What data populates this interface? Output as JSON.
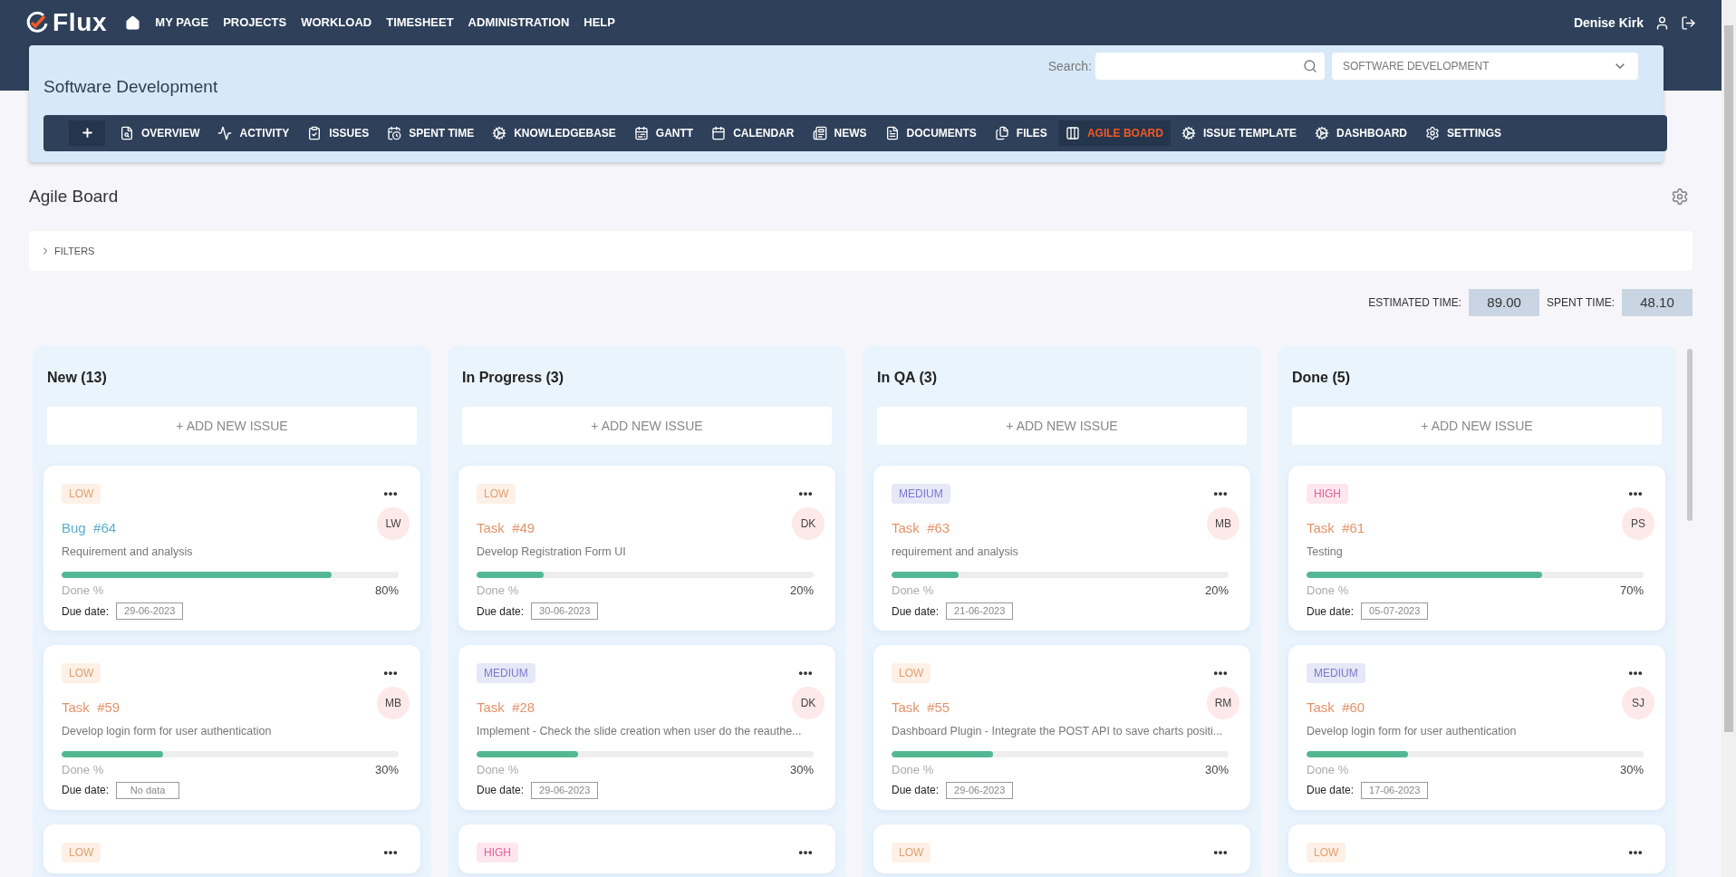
{
  "brand": {
    "name": "Flux"
  },
  "top_nav": [
    {
      "label": "MY PAGE"
    },
    {
      "label": "PROJECTS"
    },
    {
      "label": "WORKLOAD"
    },
    {
      "label": "TIMESHEET"
    },
    {
      "label": "ADMINISTRATION"
    },
    {
      "label": "HELP"
    }
  ],
  "user": {
    "name": "Denise Kirk"
  },
  "project": {
    "title": "Software Development",
    "search_label": "Search:",
    "project_select": "SOFTWARE DEVELOPMENT"
  },
  "project_nav": [
    {
      "label": "OVERVIEW",
      "selected": false
    },
    {
      "label": "ACTIVITY",
      "selected": false
    },
    {
      "label": "ISSUES",
      "selected": false
    },
    {
      "label": "SPENT TIME",
      "selected": false
    },
    {
      "label": "KNOWLEDGEBASE",
      "selected": false
    },
    {
      "label": "GANTT",
      "selected": false
    },
    {
      "label": "CALENDAR",
      "selected": false
    },
    {
      "label": "NEWS",
      "selected": false
    },
    {
      "label": "DOCUMENTS",
      "selected": false
    },
    {
      "label": "FILES",
      "selected": false
    },
    {
      "label": "AGILE BOARD",
      "selected": true
    },
    {
      "label": "ISSUE TEMPLATE",
      "selected": false
    },
    {
      "label": "DASHBOARD",
      "selected": false
    },
    {
      "label": "SETTINGS",
      "selected": false
    }
  ],
  "page_title": "Agile Board",
  "filters": {
    "label": "FILTERS",
    "expanded": false
  },
  "totals": [
    {
      "label": "ESTIMATED TIME:",
      "value": "89.00"
    },
    {
      "label": "SPENT TIME:",
      "value": "48.10"
    }
  ],
  "columns": [
    {
      "title": "New (13)",
      "add_label": "+ ADD NEW ISSUE",
      "cards": [
        {
          "priority": {
            "label": "LOW",
            "kind": "low"
          },
          "kind": "bug",
          "type": "Bug",
          "number": "#64",
          "assignee": "LW",
          "summary": "Requirement and analysis",
          "level": 0.8,
          "done_label": "Done %",
          "reading": "80%",
          "due_label": "Due date:",
          "due": "29-06-2023"
        },
        {
          "priority": {
            "label": "LOW",
            "kind": "low"
          },
          "kind": "task",
          "type": "Task",
          "number": "#59",
          "assignee": "MB",
          "summary": "Develop login form for user authentication",
          "level": 0.3,
          "done_label": "Done %",
          "reading": "30%",
          "due_label": "Due date:",
          "due": "No data"
        },
        {
          "priority": {
            "label": "LOW",
            "kind": "low"
          }
        }
      ]
    },
    {
      "title": "In Progress (3)",
      "add_label": "+ ADD NEW ISSUE",
      "cards": [
        {
          "priority": {
            "label": "LOW",
            "kind": "low"
          },
          "kind": "task",
          "type": "Task",
          "number": "#49",
          "assignee": "DK",
          "summary": "Develop Registration Form UI",
          "level": 0.2,
          "done_label": "Done %",
          "reading": "20%",
          "due_label": "Due date:",
          "due": "30-06-2023"
        },
        {
          "priority": {
            "label": "MEDIUM",
            "kind": "medium"
          },
          "kind": "task",
          "type": "Task",
          "number": "#28",
          "assignee": "DK",
          "summary": "Implement - Check the slide creation when user do the reauthe...",
          "level": 0.3,
          "done_label": "Done %",
          "reading": "30%",
          "due_label": "Due date:",
          "due": "29-06-2023"
        },
        {
          "priority": {
            "label": "HIGH",
            "kind": "high"
          }
        }
      ]
    },
    {
      "title": "In QA (3)",
      "add_label": "+ ADD NEW ISSUE",
      "cards": [
        {
          "priority": {
            "label": "MEDIUM",
            "kind": "medium"
          },
          "kind": "task",
          "type": "Task",
          "number": "#63",
          "assignee": "MB",
          "summary": "requirement and analysis",
          "level": 0.2,
          "done_label": "Done %",
          "reading": "20%",
          "due_label": "Due date:",
          "due": "21-06-2023"
        },
        {
          "priority": {
            "label": "LOW",
            "kind": "low"
          },
          "kind": "task",
          "type": "Task",
          "number": "#55",
          "assignee": "RM",
          "summary": "Dashboard Plugin - Integrate the POST API to save charts positi...",
          "level": 0.3,
          "done_label": "Done %",
          "reading": "30%",
          "due_label": "Due date:",
          "due": "29-06-2023"
        },
        {
          "priority": {
            "label": "LOW",
            "kind": "low"
          }
        }
      ]
    },
    {
      "title": "Done (5)",
      "add_label": "+ ADD NEW ISSUE",
      "cards": [
        {
          "priority": {
            "label": "HIGH",
            "kind": "high"
          },
          "kind": "task",
          "type": "Task",
          "number": "#61",
          "assignee": "PS",
          "summary": "Testing",
          "level": 0.7,
          "done_label": "Done %",
          "reading": "70%",
          "due_label": "Due date:",
          "due": "05-07-2023"
        },
        {
          "priority": {
            "label": "MEDIUM",
            "kind": "medium"
          },
          "kind": "task",
          "type": "Task",
          "number": "#60",
          "assignee": "SJ",
          "summary": "Develop login form for user authentication",
          "level": 0.3,
          "done_label": "Done %",
          "reading": "30%",
          "due_label": "Due date:",
          "due": "17-06-2023"
        },
        {
          "priority": {
            "label": "LOW",
            "kind": "low"
          }
        }
      ]
    }
  ]
}
